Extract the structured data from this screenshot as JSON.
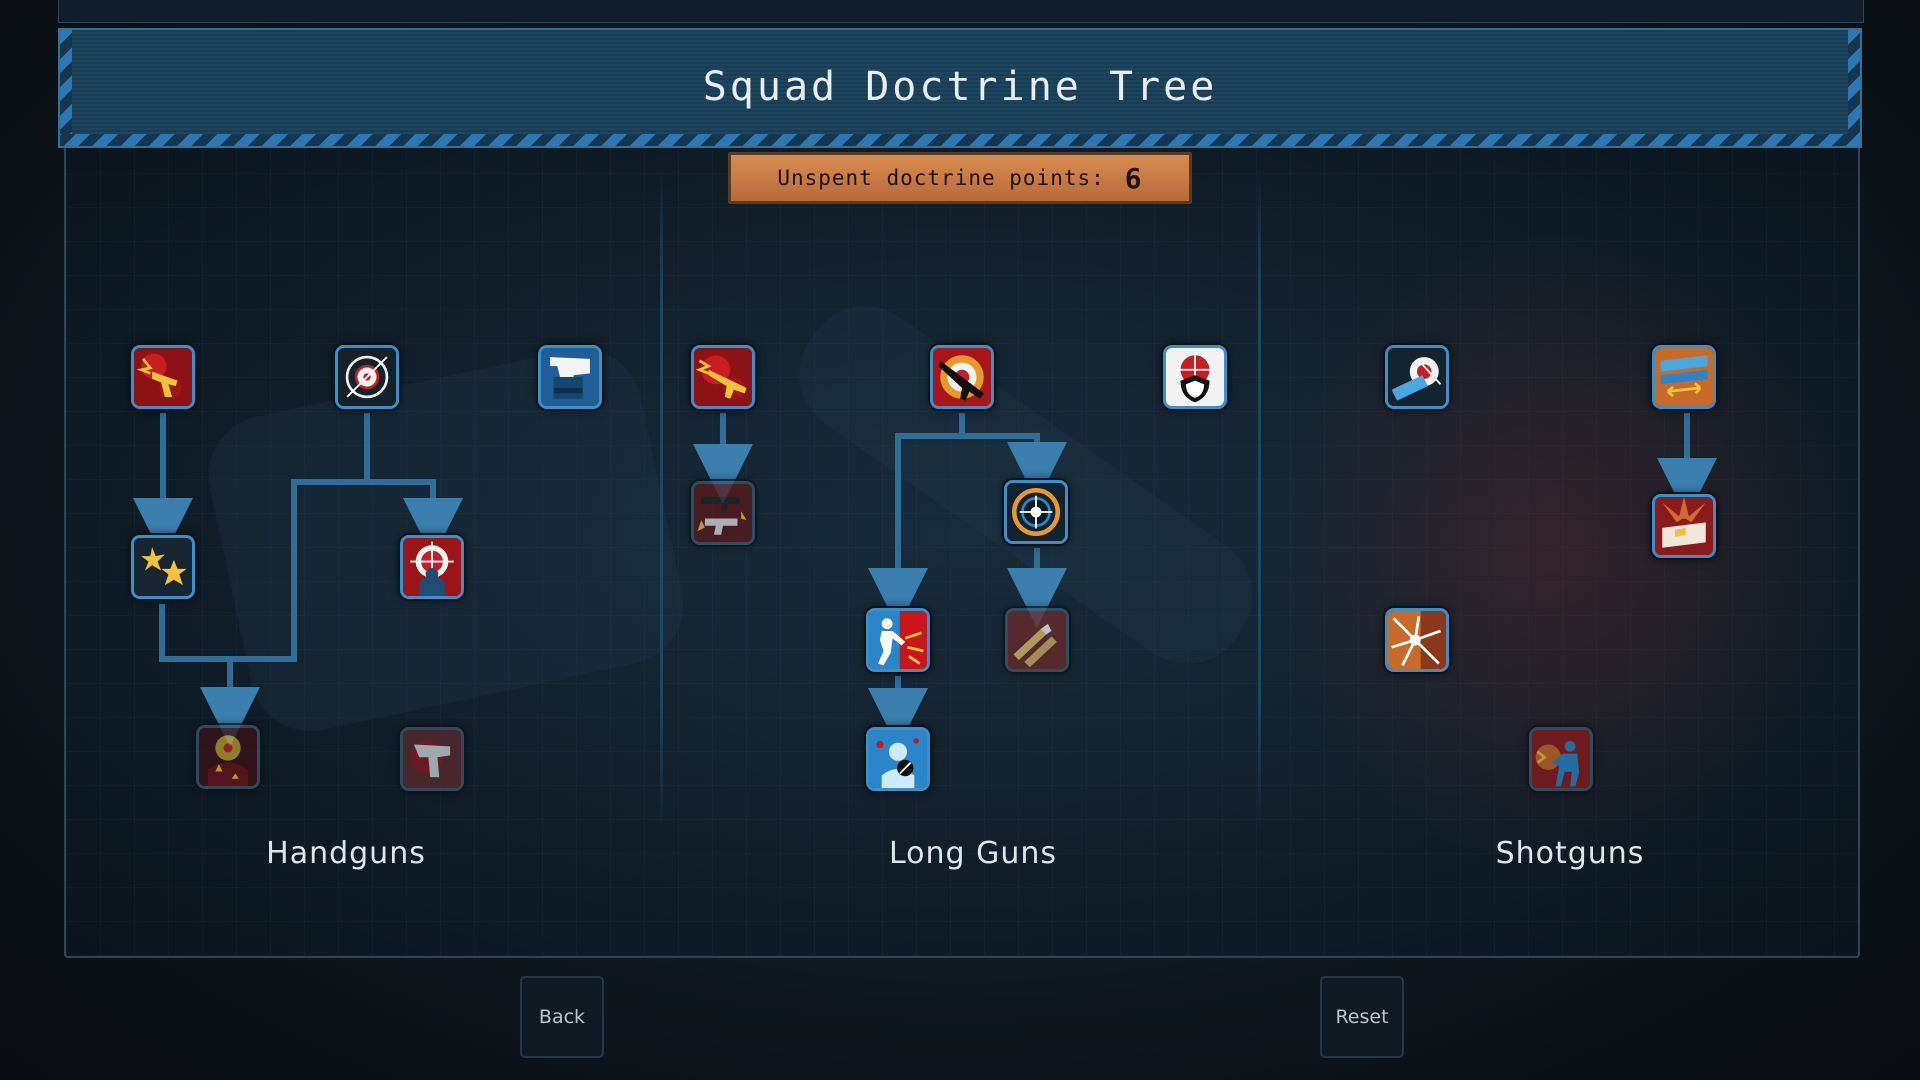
{
  "title": "Squad Doctrine Tree",
  "points": {
    "label": "Unspent doctrine points:",
    "value": "6"
  },
  "categories": [
    "Handguns",
    "Long Guns",
    "Shotguns"
  ],
  "buttons": {
    "back": "Back",
    "reset": "Reset"
  },
  "colors": {
    "accent": "#3e8fc7",
    "header": "#1d4560",
    "points_bg": "#d88d50",
    "red_icon_bg": "#b0141a",
    "gold": "#f2c23a",
    "blue_icon_bg": "#2a86c8",
    "orange_icon_bg": "#c86a2a"
  },
  "skills": [
    {
      "id": "hg-gunfire",
      "icon": "gunfire-pistol-icon"
    },
    {
      "id": "hg-crosshair",
      "icon": "crosshair-icon"
    },
    {
      "id": "hg-holster",
      "icon": "holster-pistol-icon"
    },
    {
      "id": "hg-sparks",
      "icon": "sparks-icon"
    },
    {
      "id": "hg-target-soldier",
      "icon": "target-soldier-icon"
    },
    {
      "id": "hg-hit-target",
      "icon": "hit-target-icon"
    },
    {
      "id": "hg-pistol-red",
      "icon": "pistol-silhouette-icon"
    },
    {
      "id": "lg-gunfire",
      "icon": "gunfire-rifle-icon"
    },
    {
      "id": "lg-rifle-target",
      "icon": "rifle-target-icon"
    },
    {
      "id": "lg-shield-target",
      "icon": "shield-target-icon"
    },
    {
      "id": "lg-weapons-swap",
      "icon": "weapon-swap-icon"
    },
    {
      "id": "lg-scope",
      "icon": "scope-icon"
    },
    {
      "id": "lg-kick",
      "icon": "kick-icon"
    },
    {
      "id": "lg-bullets",
      "icon": "bullets-icon"
    },
    {
      "id": "lg-stun",
      "icon": "stun-icon"
    },
    {
      "id": "sg-shell-target",
      "icon": "shell-target-icon"
    },
    {
      "id": "sg-shells",
      "icon": "shotgun-shells-icon"
    },
    {
      "id": "sg-ammo-box",
      "icon": "ammo-box-icon"
    },
    {
      "id": "sg-breach",
      "icon": "breach-door-icon"
    },
    {
      "id": "sg-shooter",
      "icon": "shooter-icon"
    }
  ]
}
